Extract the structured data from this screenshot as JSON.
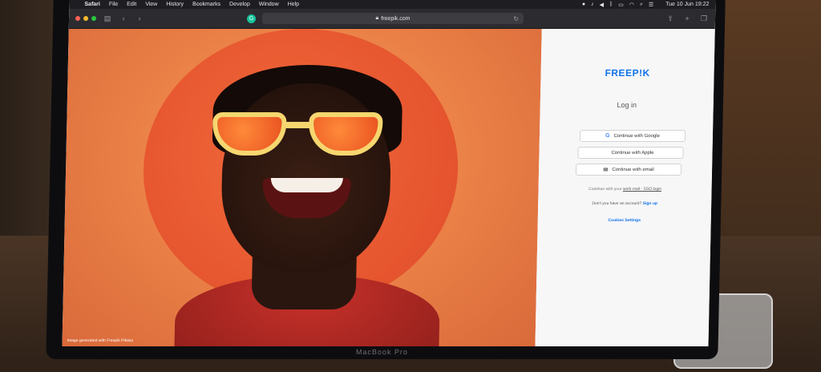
{
  "menubar": {
    "app_name": "Safari",
    "menus": [
      "File",
      "Edit",
      "View",
      "History",
      "Bookmarks",
      "Develop",
      "Window",
      "Help"
    ],
    "clock": "Tue 10 Jun  19:22"
  },
  "toolbar": {
    "url": "freepik.com"
  },
  "hero": {
    "caption": "Image generated with Freepik Pikaso"
  },
  "panel": {
    "logo": "FREEP!K",
    "title": "Log in",
    "buttons": {
      "google": "Continue with Google",
      "apple": "Continue with Apple",
      "email": "Continue with email"
    },
    "sso_prefix": "Continue with your",
    "sso_link": "work mail - SSO login",
    "signup_prefix": "Don't you have an account?",
    "signup_link": "Sign up",
    "cookies": "Cookies Settings"
  },
  "device": {
    "chin_label": "MacBook Pro"
  },
  "colors": {
    "brand": "#1273eb",
    "traffic_red": "#ff5f57",
    "traffic_yellow": "#febc2e",
    "traffic_green": "#28c840"
  }
}
